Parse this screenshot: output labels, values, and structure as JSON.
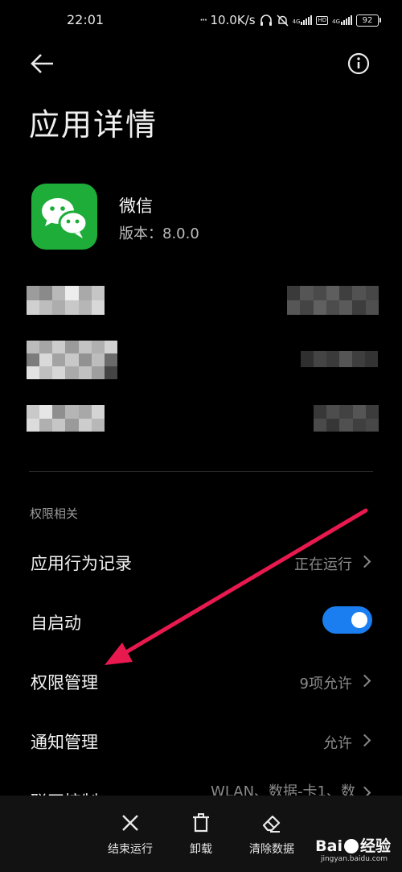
{
  "status_bar": {
    "time": "22:01",
    "dots": "···",
    "speed": "10.0K/s",
    "net_4g": "4G",
    "hd": "HD",
    "battery": "92"
  },
  "header": {
    "title": "应用详情"
  },
  "app": {
    "name": "微信",
    "version": "版本：8.0.0"
  },
  "section": {
    "label": "权限相关"
  },
  "settings": [
    {
      "label": "应用行为记录",
      "value": "正在运行"
    },
    {
      "label": "自启动",
      "toggle": true
    },
    {
      "label": "权限管理",
      "value": "9项允许"
    },
    {
      "label": "通知管理",
      "value": "允许"
    },
    {
      "label": "联网控制",
      "value": "WLAN、数据-卡1、数"
    }
  ],
  "bottom_actions": [
    {
      "label": "结束运行",
      "icon": "close-icon"
    },
    {
      "label": "卸载",
      "icon": "trash-icon"
    },
    {
      "label": "清除数据",
      "icon": "eraser-icon"
    }
  ],
  "watermark": {
    "brand": "Bai",
    "brand_end": "经验",
    "url": "jingyan.baidu.com"
  },
  "colors": {
    "background": "#000000",
    "toggle_on": "#1a7ef0",
    "app_icon": "#1dad38",
    "annotation_arrow": "#e8194f"
  }
}
